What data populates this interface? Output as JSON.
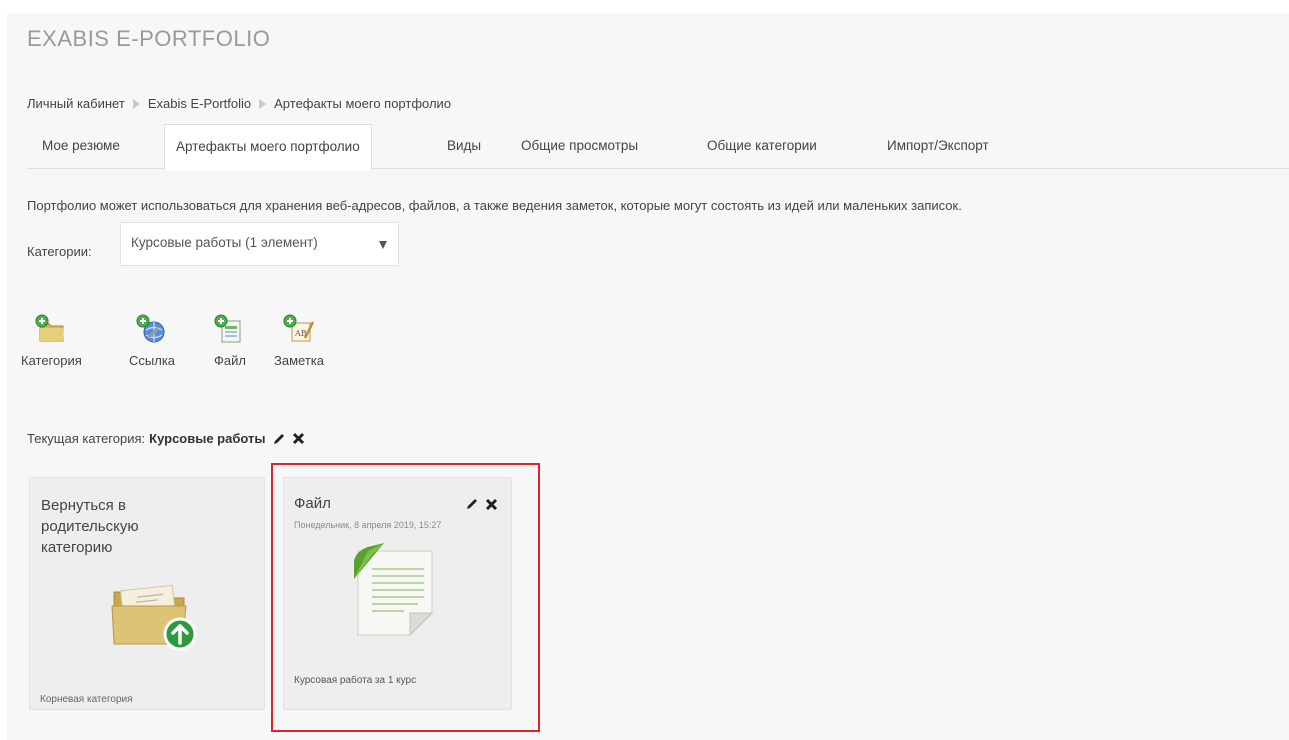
{
  "app": {
    "title": "EXABIS E-PORTFOLIO"
  },
  "breadcrumb": [
    "Личный кабинет",
    "Exabis E-Portfolio",
    "Артефакты моего портфолио"
  ],
  "tabs": [
    {
      "label": "Мое резюме",
      "active": false
    },
    {
      "label": "Артефакты моего портфолио",
      "active": true
    },
    {
      "label": "Виды",
      "active": false
    },
    {
      "label": "Общие просмотры",
      "active": false
    },
    {
      "label": "Общие категории",
      "active": false
    },
    {
      "label": "Импорт/Экспорт",
      "active": false
    }
  ],
  "description": "Портфолио может использоваться для хранения веб-адресов, файлов, а также ведения заметок, которые могут состоять из идей или маленьких записок.",
  "category_filter": {
    "label": "Категории:",
    "selected": "Курсовые работы (1 элемент)"
  },
  "toolbar": [
    {
      "label": "Категория",
      "icon": "add-category-icon"
    },
    {
      "label": "Ссылка",
      "icon": "add-link-icon"
    },
    {
      "label": "Файл",
      "icon": "add-file-icon"
    },
    {
      "label": "Заметка",
      "icon": "add-note-icon"
    }
  ],
  "current_category": {
    "label": "Текущая категория:",
    "name": "Курсовые работы"
  },
  "cards": {
    "back": {
      "title": "Вернуться в родительскую категорию",
      "footer": "Корневая категория"
    },
    "file": {
      "title": "Файл",
      "date": "Понедельник, 8 апреля 2019, 15:27",
      "description": "Курсовая работа за 1 курс"
    }
  },
  "colors": {
    "highlight": "#e0232b",
    "panel": "#f7f7f7",
    "card": "#eeeeee",
    "folder": "#d8c27a",
    "upload_badge": "#2e9a3e",
    "doc_ribbon": "#5aa12b"
  }
}
